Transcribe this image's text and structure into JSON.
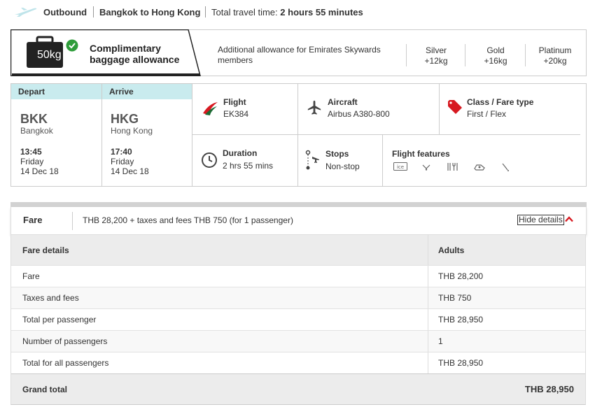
{
  "header": {
    "outbound": "Outbound",
    "route": "Bangkok to Hong Kong",
    "travel_time_label": "Total travel time:",
    "travel_time_value": "2 hours 55 minutes"
  },
  "baggage": {
    "weight": "50kg",
    "title_line1": "Complimentary",
    "title_line2": "baggage allowance",
    "additional_line1": "Additional allowance for Emirates Skywards",
    "additional_line2": "members",
    "tiers": [
      {
        "name": "Silver",
        "value": "+12kg"
      },
      {
        "name": "Gold",
        "value": "+16kg"
      },
      {
        "name": "Platinum",
        "value": "+20kg"
      }
    ]
  },
  "flight": {
    "depart": {
      "label": "Depart",
      "code": "BKK",
      "city": "Bangkok",
      "time": "13:45",
      "day": "Friday",
      "date": "14 Dec 18"
    },
    "arrive": {
      "label": "Arrive",
      "code": "HKG",
      "city": "Hong Kong",
      "time": "17:40",
      "day": "Friday",
      "date": "14 Dec 18"
    },
    "flight_label": "Flight",
    "flight_number": "EK384",
    "aircraft_label": "Aircraft",
    "aircraft": "Airbus A380-800",
    "class_label": "Class / Fare type",
    "class_value": "First / Flex",
    "duration_label": "Duration",
    "duration": "2 hrs 55 mins",
    "stops_label": "Stops",
    "stops": "Non-stop",
    "features_label": "Flight features",
    "features": [
      "ice-icon",
      "wifi-icon",
      "dining-icon",
      "lounge-icon",
      "shower-icon"
    ]
  },
  "fare": {
    "label": "Fare",
    "summary": "THB 28,200 + taxes and fees THB 750 (for 1 passenger)",
    "hide_details": "Hide details",
    "table": {
      "col1": "Fare details",
      "col2": "Adults",
      "rows": [
        {
          "label": "Fare",
          "value": "THB 28,200"
        },
        {
          "label": "Taxes and fees",
          "value": "THB 750"
        },
        {
          "label": "Total per passenger",
          "value": "THB 28,950"
        },
        {
          "label": "Number of passengers",
          "value": "1"
        },
        {
          "label": "Total for all passengers",
          "value": "THB 28,950"
        }
      ],
      "grand_total_label": "Grand total",
      "grand_total_value": "THB 28,950"
    }
  },
  "colors": {
    "header_cell": "#c9ebee",
    "emirates_red": "#d71921",
    "check_green": "#2e9d3a"
  }
}
